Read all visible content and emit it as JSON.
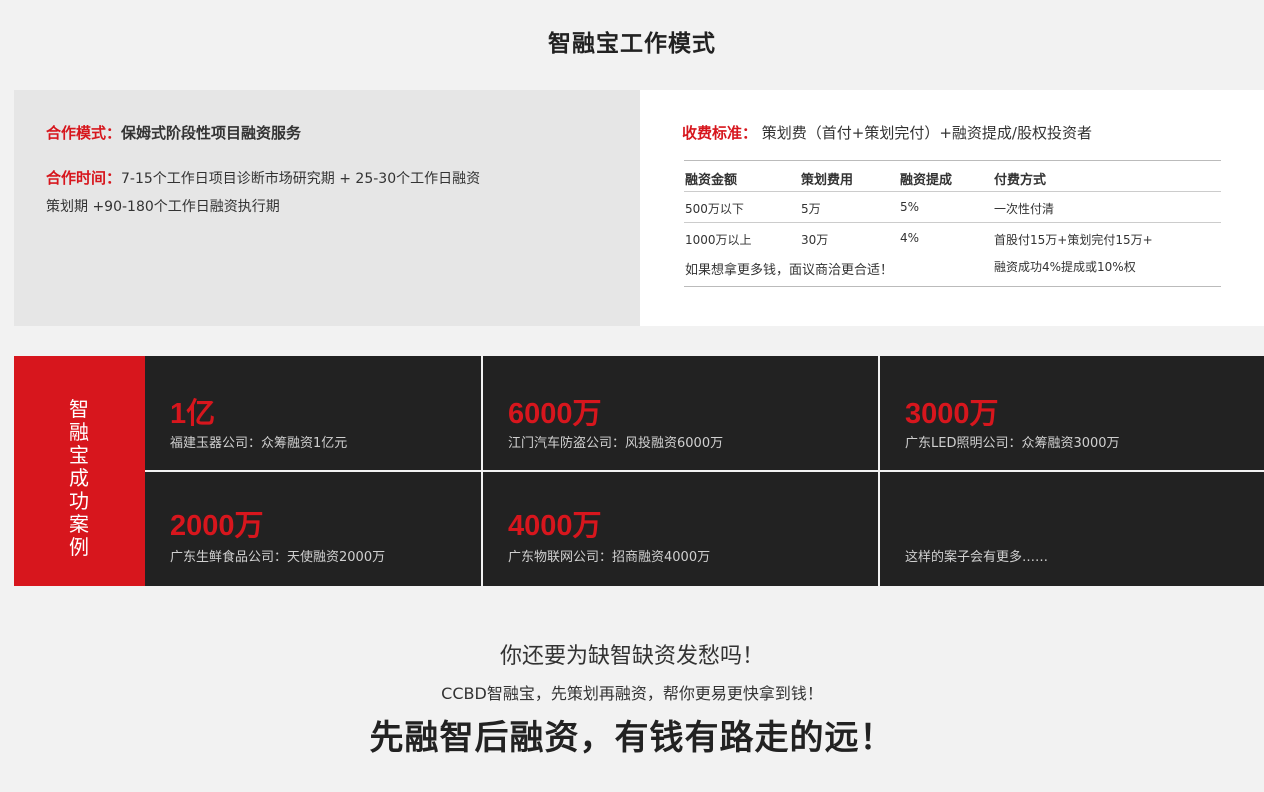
{
  "page_title": "智融宝工作模式",
  "mode": {
    "cooperation_label": "合作模式：",
    "cooperation_value": "保姆式阶段性项目融资服务",
    "time_label": "合作时间：",
    "time_value": "7-15个工作日项目诊断市场研究期 + 25-30个工作日融资策划期 +90-180个工作日融资执行期"
  },
  "fee": {
    "label": "收费标准：",
    "value": "策划费（首付+策划完付）+融资提成/股权投资者",
    "headers": [
      "融资金额",
      "策划费用",
      "融资提成",
      "付费方式"
    ],
    "rows": [
      [
        "500万以下",
        "5万",
        "5%",
        "一次性付清"
      ],
      [
        "1000万以上",
        "30万",
        "4%",
        "首股付15万+策划完付15万+"
      ]
    ],
    "note": "如果想拿更多钱，面议商洽更合适！",
    "pay_continued": "融资成功4%提成或10%权"
  },
  "cases": {
    "label": "智融宝成功案例",
    "items": [
      {
        "amount": "1亿",
        "desc": "福建玉器公司：众筹融资1亿元"
      },
      {
        "amount": "6000万",
        "desc": "江门汽车防盗公司：风投融资6000万"
      },
      {
        "amount": "3000万",
        "desc": "广东LED照明公司：众筹融资3000万"
      },
      {
        "amount": "2000万",
        "desc": "广东生鲜食品公司：天使融资2000万"
      },
      {
        "amount": "4000万",
        "desc": "广东物联网公司：招商融资4000万"
      },
      {
        "amount": "",
        "desc": "这样的案子会有更多……"
      }
    ]
  },
  "bottom": {
    "line1": "你还要为缺智缺资发愁吗！",
    "line2": "CCBD智融宝，先策划再融资，帮你更易更快拿到钱！",
    "line3": "先融智后融资，有钱有路走的远！"
  },
  "colors": {
    "accent": "#d7161d",
    "dark": "#222222"
  }
}
